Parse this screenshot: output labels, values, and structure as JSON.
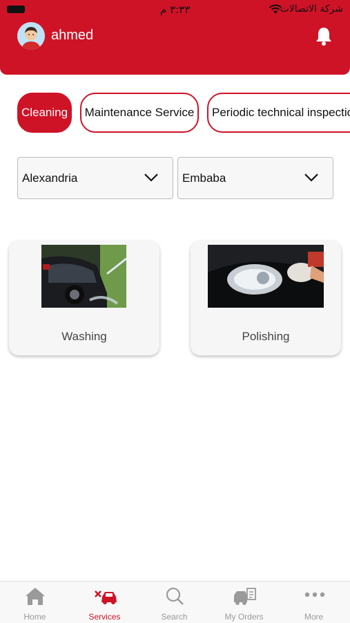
{
  "status_bar": {
    "time": "٣:٣٣ م",
    "carrier": "شركة الاتصالات"
  },
  "header": {
    "username": "ahmed"
  },
  "tabs": [
    {
      "label": "Cleaning",
      "active": true
    },
    {
      "label": "Maintenance Service",
      "active": false
    },
    {
      "label": "Periodic technical inspection",
      "active": false
    }
  ],
  "filters": {
    "governorate": "Alexandria",
    "district": "Embaba"
  },
  "services": [
    {
      "label": "Washing"
    },
    {
      "label": "Polishing"
    }
  ],
  "bottom_nav": [
    {
      "label": "Home",
      "icon": "home-icon"
    },
    {
      "label": "Services",
      "icon": "services-icon",
      "active": true
    },
    {
      "label": "Search",
      "icon": "search-icon"
    },
    {
      "label": "My Orders",
      "icon": "orders-icon"
    },
    {
      "label": "More",
      "icon": "more-icon"
    }
  ],
  "colors": {
    "accent": "#cf1327",
    "nav_inactive": "#999999"
  }
}
